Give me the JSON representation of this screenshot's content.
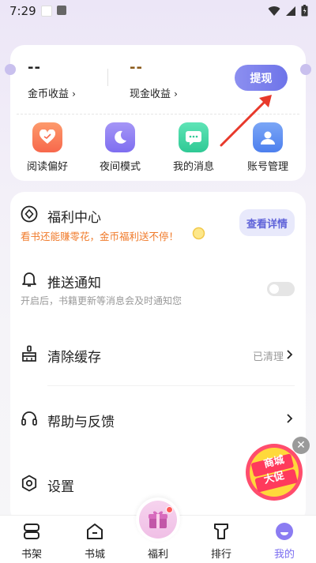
{
  "status_bar": {
    "time": "7:29"
  },
  "earnings": {
    "coin": {
      "value": "--",
      "label": "金币收益"
    },
    "cash": {
      "value": "--",
      "label": "现金收益"
    },
    "withdraw_label": "提现",
    "arrow_glyph": "›"
  },
  "quick_actions": [
    {
      "label": "阅读偏好",
      "icon": "heart-icon",
      "color": "#fb7a5d"
    },
    {
      "label": "夜间模式",
      "icon": "moon-icon",
      "color": "#8c7cf0"
    },
    {
      "label": "我的消息",
      "icon": "message-icon",
      "color": "#3fd5a4"
    },
    {
      "label": "账号管理",
      "icon": "user-icon",
      "color": "#5c8ff2"
    }
  ],
  "settings": {
    "welfare": {
      "title": "福利中心",
      "subtitle": "看书还能赚零花，金币福利送不停！",
      "button": "查看详情"
    },
    "push": {
      "title": "推送通知",
      "subtitle": "开启后，书籍更新等消息会及时通知您",
      "enabled": false
    },
    "cache": {
      "title": "清除缓存",
      "status": "已清理"
    },
    "help": {
      "title": "帮助与反馈"
    },
    "settings": {
      "title": "设置"
    }
  },
  "promo": {
    "line1": "商城",
    "line2": "大促"
  },
  "tabbar": [
    {
      "label": "书架",
      "icon": "bookshelf-icon",
      "active": false
    },
    {
      "label": "书城",
      "icon": "bookstore-icon",
      "active": false
    },
    {
      "label": "福利",
      "icon": "gift-icon",
      "active": false
    },
    {
      "label": "排行",
      "icon": "ranking-icon",
      "active": false
    },
    {
      "label": "我的",
      "icon": "profile-icon",
      "active": true
    }
  ],
  "colors": {
    "accent": "#6e74e9",
    "welfare_text": "#f07a2a",
    "active_tab": "#7a6cf0"
  }
}
